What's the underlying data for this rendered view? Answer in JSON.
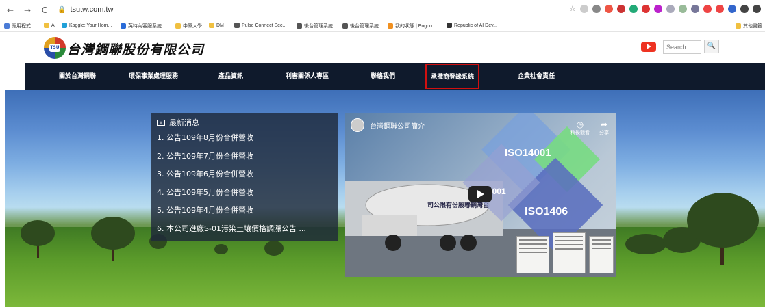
{
  "browser": {
    "url": "tsutw.com.tw",
    "nav": [
      "←",
      "→",
      "C",
      "⌂"
    ],
    "extension_colors": [
      "#ccc",
      "#888",
      "#e54",
      "#c33",
      "#2a7",
      "#d33",
      "#b2c",
      "#aab",
      "#9b9",
      "#779",
      "#e44",
      "#e44",
      "#36c",
      "#444",
      "#444"
    ]
  },
  "bookmarks": {
    "items": [
      {
        "label": "應用程式",
        "color": "#4a7bd6"
      },
      {
        "label": "AI",
        "color": "#f0c040"
      },
      {
        "label": "Kaggle: Your Hom...",
        "color": "#20a0d8"
      },
      {
        "label": "英特內容服系統",
        "color": "#2a6bd8"
      },
      {
        "label": "中原大學",
        "color": "#f0c040"
      },
      {
        "label": "DM",
        "color": "#f0c040"
      },
      {
        "label": "Pulse Connect Sec...",
        "color": "#555"
      },
      {
        "label": "後台管理系統",
        "color": "#555"
      },
      {
        "label": "後台管理系統",
        "color": "#555"
      },
      {
        "label": "我的狀態 | Engoo...",
        "color": "#f09020"
      },
      {
        "label": "Republic of AI Dev...",
        "color": "#333"
      }
    ],
    "other": "其他書籤"
  },
  "header": {
    "company_name": "台灣鋼聯股份有限公司",
    "logo_text": "TSU",
    "search_placeholder": "Search..."
  },
  "nav": {
    "items": [
      "關於台灣鋼聯",
      "環保事業處理服務",
      "產品資訊",
      "利害關係人專區",
      "聯絡我們",
      "承攬商登錄系統",
      "企業社會責任"
    ],
    "active_index": 5
  },
  "news": {
    "title": "最新消息",
    "items": [
      "1. 公告109年8月份合併營收",
      "2. 公告109年7月份合併營收",
      "3. 公告109年6月份合併營收",
      "4. 公告109年5月份合併營收",
      "5. 公告109年4月份合併營收",
      "6. 本公司進廠S-01污染土壤價格調漲公告 ..."
    ]
  },
  "video": {
    "title": "台灣鋼聯公司簡介",
    "watch_later": "稍後觀看",
    "share": "分享",
    "iso_labels": [
      "ISO14001",
      "9001",
      "ISO1406"
    ],
    "truck_text": "司公限有份股聯鋼灣台"
  }
}
